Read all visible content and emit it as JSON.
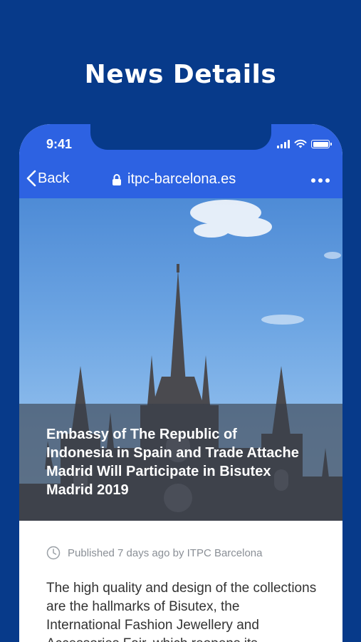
{
  "screen": {
    "title": "News Details"
  },
  "status_bar": {
    "time": "9:41"
  },
  "browser": {
    "back_label": "Back",
    "url": "itpc-barcelona.es"
  },
  "article": {
    "headline": "Embassy of The Republic of Indonesia in Spain and Trade Attache Madrid Will Participate in Bisutex Madrid 2019",
    "meta": "Published 7 days ago by ITPC Barcelona",
    "body": "The high quality and design of the collections are the hallmarks of Bisutex, the International Fashion Jewellery and Accessories Fair, which reopens its"
  },
  "colors": {
    "background": "#073a8a",
    "header_bar": "#2d62e2"
  },
  "icons": {
    "back": "chevron-left-icon",
    "lock": "lock-icon",
    "more": "more-dots-icon",
    "clock": "clock-icon"
  }
}
